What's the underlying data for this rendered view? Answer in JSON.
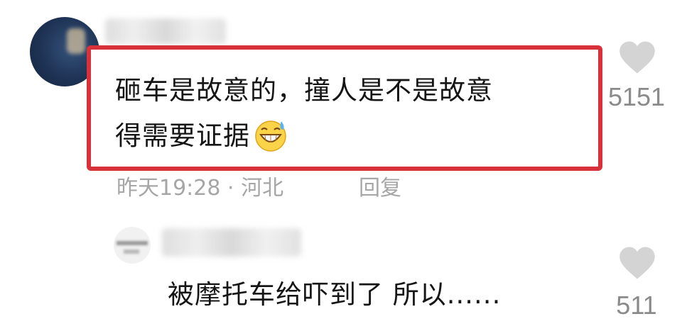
{
  "comments": [
    {
      "text_line1": "砸车是故意的，撞人是不是故意",
      "text_line2": "得需要证据",
      "emoji": "grinning-sweat-emoji",
      "time": "昨天19:28",
      "separator": "·",
      "location": "河北",
      "reply_label": "回复",
      "likes": "5151",
      "highlighted": true,
      "highlight_color": "#d8313a"
    },
    {
      "text": "被摩托车给吓到了 所以......",
      "likes": "511"
    }
  ],
  "colors": {
    "like_icon": "#d4d4d4",
    "meta_text": "#a6a6a6"
  }
}
